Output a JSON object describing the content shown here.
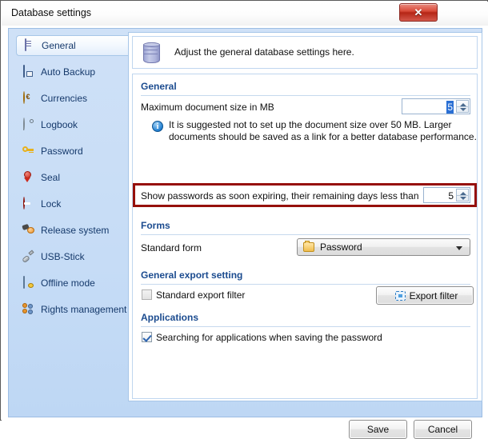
{
  "window": {
    "title": "Database settings",
    "close_label": "✕"
  },
  "sidebar": {
    "items": [
      {
        "label": "General",
        "icon": "database-icon",
        "selected": true
      },
      {
        "label": "Auto Backup",
        "icon": "backup-disk-icon",
        "selected": false
      },
      {
        "label": "Currencies",
        "icon": "euro-coin-icon",
        "selected": false
      },
      {
        "label": "Logbook",
        "icon": "logbook-icon",
        "selected": false
      },
      {
        "label": "Password",
        "icon": "key-icon",
        "selected": false
      },
      {
        "label": "Seal",
        "icon": "seal-ribbon-icon",
        "selected": false
      },
      {
        "label": "Lock",
        "icon": "no-entry-lock-icon",
        "selected": false
      },
      {
        "label": "Release system",
        "icon": "release-hammer-icon",
        "selected": false
      },
      {
        "label": "USB-Stick",
        "icon": "usb-stick-icon",
        "selected": false
      },
      {
        "label": "Offline mode",
        "icon": "offline-mode-icon",
        "selected": false
      },
      {
        "label": "Rights management",
        "icon": "users-group-icon",
        "selected": false
      }
    ]
  },
  "header": {
    "icon": "database-cylinder-icon",
    "text": "Adjust the general database settings here."
  },
  "general": {
    "title": "General",
    "max_doc_label": "Maximum document size in MB",
    "max_doc_value": "5",
    "info_icon": "info-icon",
    "info_text_line1": "It is suggested not to set up the document size over 50 MB. Larger",
    "info_text_line2": "documents should be saved as a link for a better database performance.",
    "expiring_label": "Show passwords as soon expiring, their remaining days less than",
    "expiring_value": "5",
    "highlight_color": "#96100b"
  },
  "forms": {
    "title": "Forms",
    "standard_form_label": "Standard form",
    "standard_form_value": "Password",
    "standard_form_icon": "folder-icon",
    "dropdown_arrow": "chevron-down-icon"
  },
  "export": {
    "title": "General export setting",
    "checkbox_label": "Standard export filter",
    "checkbox_checked": false,
    "button_label": "Export filter",
    "button_icon": "export-filter-icon"
  },
  "applications": {
    "title": "Applications",
    "checkbox_label": "Searching for applications when saving the password",
    "checkbox_checked": true
  },
  "footer": {
    "save_label": "Save",
    "cancel_label": "Cancel"
  },
  "colors": {
    "accent_blue": "#1b4b8f",
    "panel_blue": "#c6dcf6",
    "highlight_red": "#96100b",
    "selection_blue": "#2a6fd4"
  }
}
